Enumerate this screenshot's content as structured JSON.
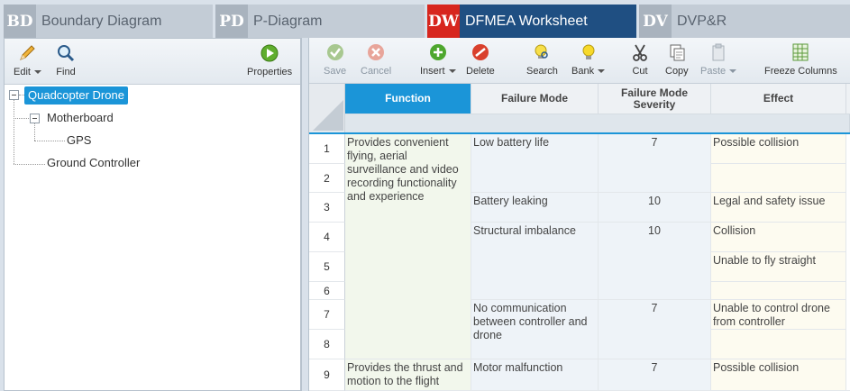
{
  "tabs": [
    {
      "abbr": "BD",
      "name": "Boundary Diagram",
      "active": false
    },
    {
      "abbr": "PD",
      "name": "P-Diagram",
      "active": false
    },
    {
      "abbr": "DW",
      "name": "DFMEA Worksheet",
      "active": true
    },
    {
      "abbr": "DV",
      "name": "DVP&R",
      "active": false
    }
  ],
  "left_toolbar": {
    "edit": "Edit",
    "find": "Find",
    "properties": "Properties"
  },
  "tree": {
    "root": "Quadcopter Drone",
    "motherboard": "Motherboard",
    "gps": "GPS",
    "ground_controller": "Ground Controller"
  },
  "right_toolbar": {
    "save": "Save",
    "cancel": "Cancel",
    "insert": "Insert",
    "delete": "Delete",
    "search": "Search",
    "bank": "Bank",
    "cut": "Cut",
    "copy": "Copy",
    "paste": "Paste",
    "freeze": "Freeze Columns"
  },
  "columns": {
    "function": "Function",
    "failure_mode": "Failure Mode",
    "severity": "Failure Mode Severity",
    "effect": "Effect"
  },
  "row_numbers": [
    "1",
    "2",
    "3",
    "4",
    "5",
    "6",
    "7",
    "8",
    "9"
  ],
  "rows": {
    "fn1": "Provides convenient flying, aerial surveillance and video recording functionality and experience",
    "fn2": "Provides the thrust and motion to the flight",
    "fm1": "Low battery life",
    "fm2": "Battery leaking",
    "fm3": "Structural imbalance",
    "fm4": "No communication between controller and drone",
    "fm5": "Motor malfunction",
    "sev1": "7",
    "sev2": "10",
    "sev3": "10",
    "sev4": "7",
    "sev5": "7",
    "eff1": "Possible collision",
    "eff2": "Legal and safety issue",
    "eff3": "Collision",
    "eff4": "Unable to fly straight",
    "eff5": "Unable to control drone from controller",
    "eff6": "Possible collision"
  },
  "colors": {
    "active_tab": "#1f4f82",
    "active_abbr": "#d7261e",
    "selection": "#1b95d8"
  }
}
